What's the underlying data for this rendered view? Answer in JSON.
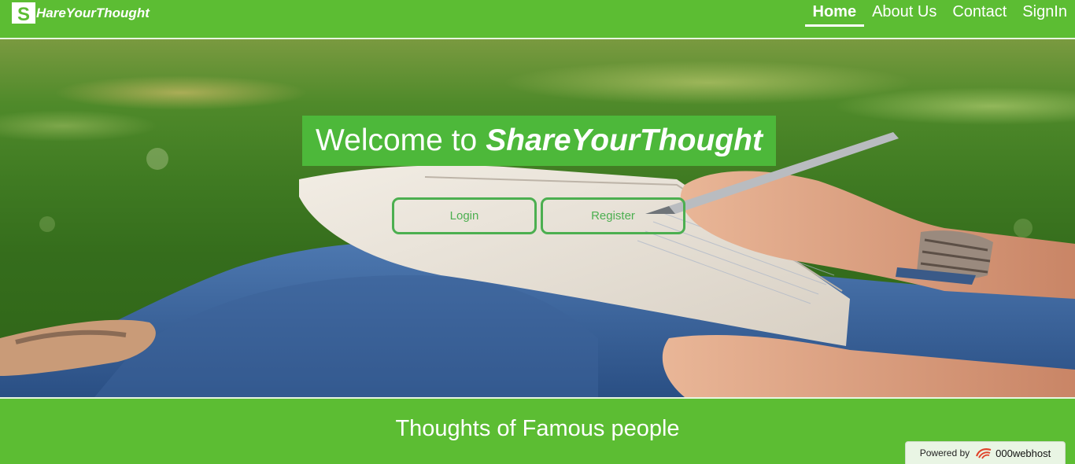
{
  "navbar": {
    "brand_initial": "S",
    "brand_name": "HareYourThought",
    "links": [
      {
        "label": "Home",
        "active": true
      },
      {
        "label": "About Us",
        "active": false
      },
      {
        "label": "Contact",
        "active": false
      },
      {
        "label": "SignIn",
        "active": false
      }
    ]
  },
  "hero": {
    "welcome_prefix": "Welcome to",
    "welcome_brand": "ShareYourThought",
    "login_label": "Login",
    "register_label": "Register"
  },
  "section": {
    "title": "Thoughts of Famous people"
  },
  "badge": {
    "powered_label": "Powered by",
    "host_name": "000webhost"
  },
  "colors": {
    "brand_green": "#5cbd33",
    "button_green": "#4caf50",
    "welcome_bg": "#4db83a"
  }
}
